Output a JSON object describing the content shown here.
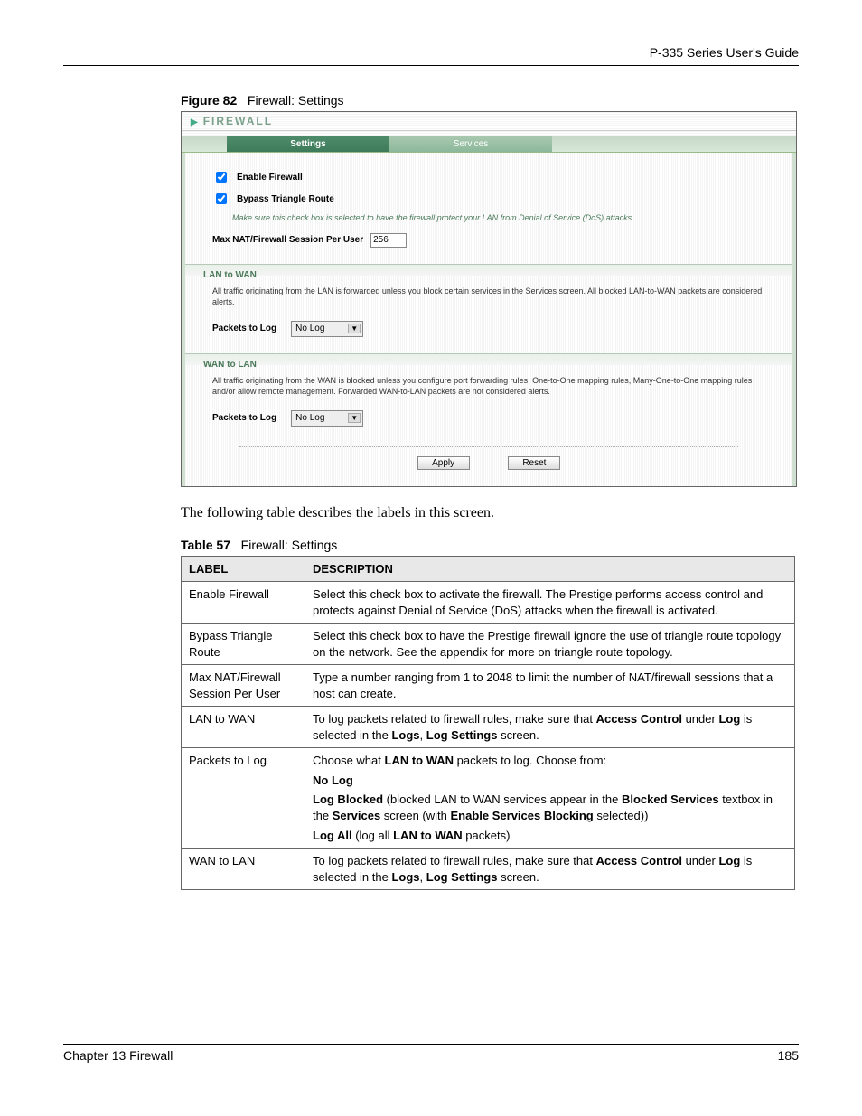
{
  "header": {
    "guide": "P-335 Series User's Guide"
  },
  "figure": {
    "label": "Figure 82",
    "title": "Firewall: Settings"
  },
  "screenshot": {
    "pageTitle": "FIREWALL",
    "tabs": {
      "active": "Settings",
      "other": "Services"
    },
    "enableFirewall": "Enable Firewall",
    "bypass": "Bypass Triangle Route",
    "bypassNote": "Make sure this check box is selected to have the firewall protect your LAN from Denial of Service (DoS) attacks.",
    "maxLabel": "Max NAT/Firewall Session Per User",
    "maxValue": "256",
    "lanHeader": "LAN to WAN",
    "lanDesc": "All traffic originating from the LAN is forwarded unless you block certain services in the Services screen. All blocked LAN-to-WAN packets are considered alerts.",
    "packetsLabel": "Packets to Log",
    "packetsValue": "No Log",
    "wanHeader": "WAN to LAN",
    "wanDesc": "All traffic originating from the WAN is blocked unless you configure port forwarding rules, One-to-One mapping rules, Many-One-to-One mapping rules and/or allow remote management. Forwarded WAN-to-LAN packets are not considered alerts.",
    "apply": "Apply",
    "reset": "Reset"
  },
  "bodyText": "The following table describes the labels in this screen.",
  "tableCaption": {
    "label": "Table 57",
    "title": "Firewall: Settings"
  },
  "table": {
    "hLabel": "LABEL",
    "hDesc": "DESCRIPTION",
    "rows": [
      {
        "label": "Enable Firewall",
        "desc": "Select this check box to activate the firewall. The Prestige performs access control and protects against Denial of Service (DoS) attacks when the firewall is activated."
      },
      {
        "label": "Bypass Triangle Route",
        "desc": "Select this check box to have the Prestige firewall ignore the use of triangle route topology on the network. See the appendix for more on triangle route topology."
      },
      {
        "label": "Max NAT/Firewall Session Per User",
        "desc": "Type a number ranging from 1 to 2048 to limit the number of NAT/firewall sessions that a host can create."
      },
      {
        "label": "LAN to WAN",
        "desc": "To log packets related to firewall rules, make sure that <b>Access Control</b> under <b>Log</b> is selected in the <b>Logs</b>, <b>Log Settings</b> screen."
      },
      {
        "label": "Packets to Log",
        "desc": "<p>Choose what <b>LAN to WAN</b> packets to log. Choose from:</p><p><b>No Log</b></p><p><b>Log Blocked</b> (blocked LAN to WAN services appear in the <b>Blocked Services</b> textbox in the <b>Services</b> screen (with <b>Enable Services Blocking</b> selected))</p><p><b>Log All</b> (log all <b>LAN to WAN</b> packets)</p>"
      },
      {
        "label": "WAN to LAN",
        "desc": "To log packets related to firewall rules, make sure that <b>Access Control</b> under <b>Log</b> is selected in the <b>Logs</b>, <b>Log Settings</b> screen."
      }
    ]
  },
  "footer": {
    "left": "Chapter 13 Firewall",
    "right": "185"
  }
}
